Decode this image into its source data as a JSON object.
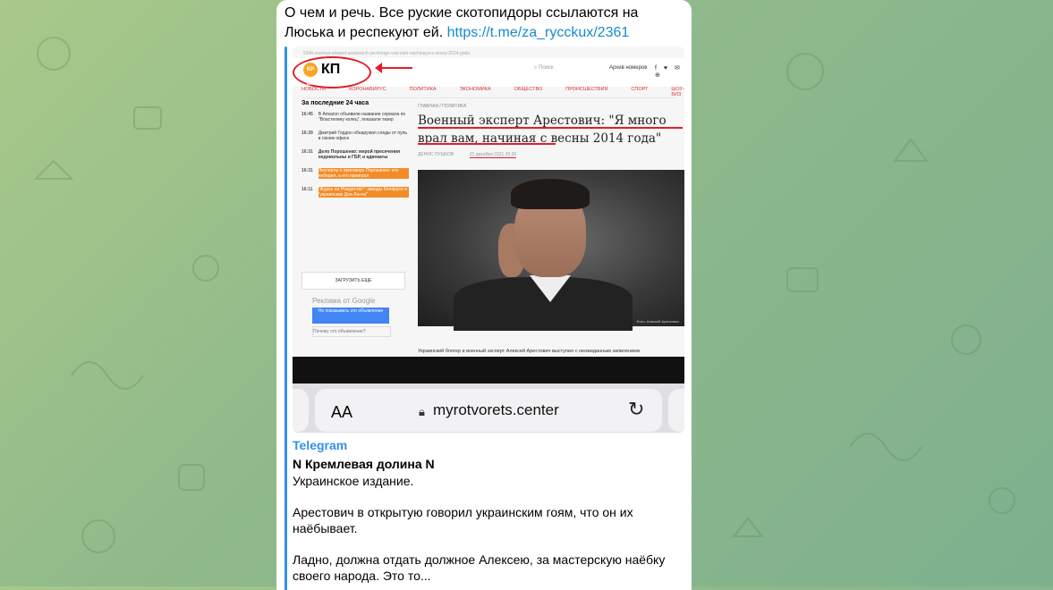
{
  "message": {
    "text": "О чем и речь. Все руские скотопидоры ссылаются на Люська и респекуют ей.",
    "link": "https://t.me/za_rycckux/2361"
  },
  "preview_image": {
    "url_line": "5346-voennyi-ekspert-arestovich-ya-mnogo-vral-vam-nachinaya-s-vesny-2014-goda",
    "logo_badge": "KP UA",
    "logo_text": "КП",
    "search_placeholder": "Поиск",
    "archive": "Архив номеров",
    "social": "f ♥ ✉ ⊕",
    "nav": [
      "НОВОСТИ",
      "КОРОНАВИРУС",
      "ПОЛИТИКА",
      "ЭКОНОМИКА",
      "ОБЩЕСТВО",
      "ПРОИСШЕСТВИЯ",
      "СПОРТ",
      "ШОУ-БИЗ"
    ],
    "sidebar_title": "За последние 24 часа",
    "sidebar_items": [
      {
        "time": "16:45",
        "text": "В Amazon объявили название сериала по \"Властелину колец\", показали тизер"
      },
      {
        "time": "16:39",
        "text": "Дмитрий Гордон обнаружил следы от пуль в своем офисе"
      },
      {
        "time": "16:31",
        "text": "Дело Порошенко: мерой пресечения недовольны и ГБР, и адвокаты"
      },
      {
        "time": "16:31",
        "text": "Эксперты о приговоре Порошенко: кто победил, а кто проиграл"
      },
      {
        "time": "16:11",
        "text": "\"Ждать на Рождество\": заводы Беларуси и \"украинская Доx-Лента\""
      }
    ],
    "load_more": "ЗАГРУЗИТЬ ЕЩЕ",
    "ad_label": "Реклама от Google",
    "ad_button": "Не показывать это объявление",
    "ad_why": "Почему это объявление?",
    "breadcrumbs": "ГЛАВНАЯ / ПОЛИТИКА",
    "headline": "Военный эксперт Арестович: \"Я много врал вам, начиная с весны 2014 года\"",
    "byline_author": "ДЕНИС ПУШКОВ",
    "byline_date": "21 декабря 2021 20:30",
    "photo_caption": "Фото: Алексей Арестович",
    "lead": "Украинский блогер и военный эксперт Алексей Арестович выступил с неожиданным заявлением",
    "browser_aa": "AA",
    "browser_url": "myrotvorets.center"
  },
  "link_preview": {
    "site_name": "Telegram",
    "title": "N Кремлевая долина N",
    "paragraphs": [
      "Украинское издание.",
      "Арестович в открытую говорил украинским гоям, что он их наёбывает.",
      "Ладно, должна отдать должное Алексею, за мастерскую наёбку своего народа. Это то..."
    ]
  },
  "colors": {
    "link": "#168acd",
    "preview_accent": "#3390ec",
    "highlight_red": "#e21d2a"
  }
}
